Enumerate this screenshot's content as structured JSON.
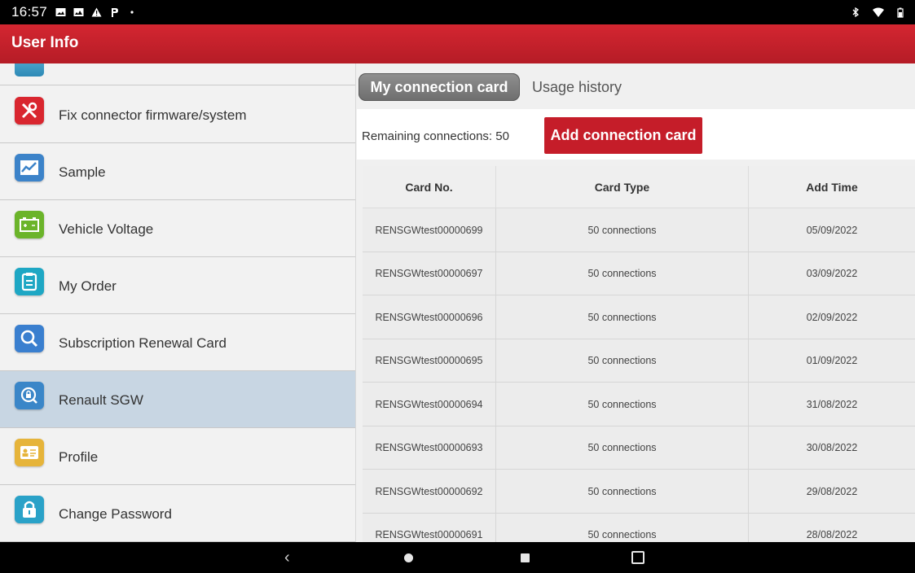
{
  "status_bar": {
    "time": "16:57"
  },
  "app": {
    "title": "User Info"
  },
  "sidebar": {
    "items": [
      {
        "label": "Fix connector firmware/system",
        "icon": "tools-icon",
        "color": "#d9262f"
      },
      {
        "label": "Sample",
        "icon": "chart-icon",
        "color": "#3c83c9"
      },
      {
        "label": "Vehicle Voltage",
        "icon": "battery-icon",
        "color": "#6bb42a"
      },
      {
        "label": "My Order",
        "icon": "clipboard-icon",
        "color": "#1ea7c4"
      },
      {
        "label": "Subscription Renewal Card",
        "icon": "magnifier-icon",
        "color": "#3a7fcf"
      },
      {
        "label": "Renault SGW",
        "icon": "lock-search-icon",
        "color": "#3a86c8",
        "active": true
      },
      {
        "label": "Profile",
        "icon": "id-card-icon",
        "color": "#e6b43a"
      },
      {
        "label": "Change Password",
        "icon": "padlock-icon",
        "color": "#2aa2c8"
      }
    ]
  },
  "tabs": {
    "active": "My connection card",
    "other": "Usage history"
  },
  "toolbar": {
    "remaining_label": "Remaining connections:",
    "remaining_value": "50",
    "add_button": "Add connection card"
  },
  "table": {
    "headers": [
      "Card No.",
      "Card Type",
      "Add Time"
    ],
    "rows": [
      [
        "RENSGWtest00000699",
        "50 connections",
        "05/09/2022"
      ],
      [
        "RENSGWtest00000697",
        "50 connections",
        "03/09/2022"
      ],
      [
        "RENSGWtest00000696",
        "50 connections",
        "02/09/2022"
      ],
      [
        "RENSGWtest00000695",
        "50 connections",
        "01/09/2022"
      ],
      [
        "RENSGWtest00000694",
        "50 connections",
        "31/08/2022"
      ],
      [
        "RENSGWtest00000693",
        "50 connections",
        "30/08/2022"
      ],
      [
        "RENSGWtest00000692",
        "50 connections",
        "29/08/2022"
      ],
      [
        "RENSGWtest00000691",
        "50 connections",
        "28/08/2022"
      ]
    ]
  },
  "colors": {
    "brand_red": "#c51d29",
    "header_red": "#d42631"
  }
}
